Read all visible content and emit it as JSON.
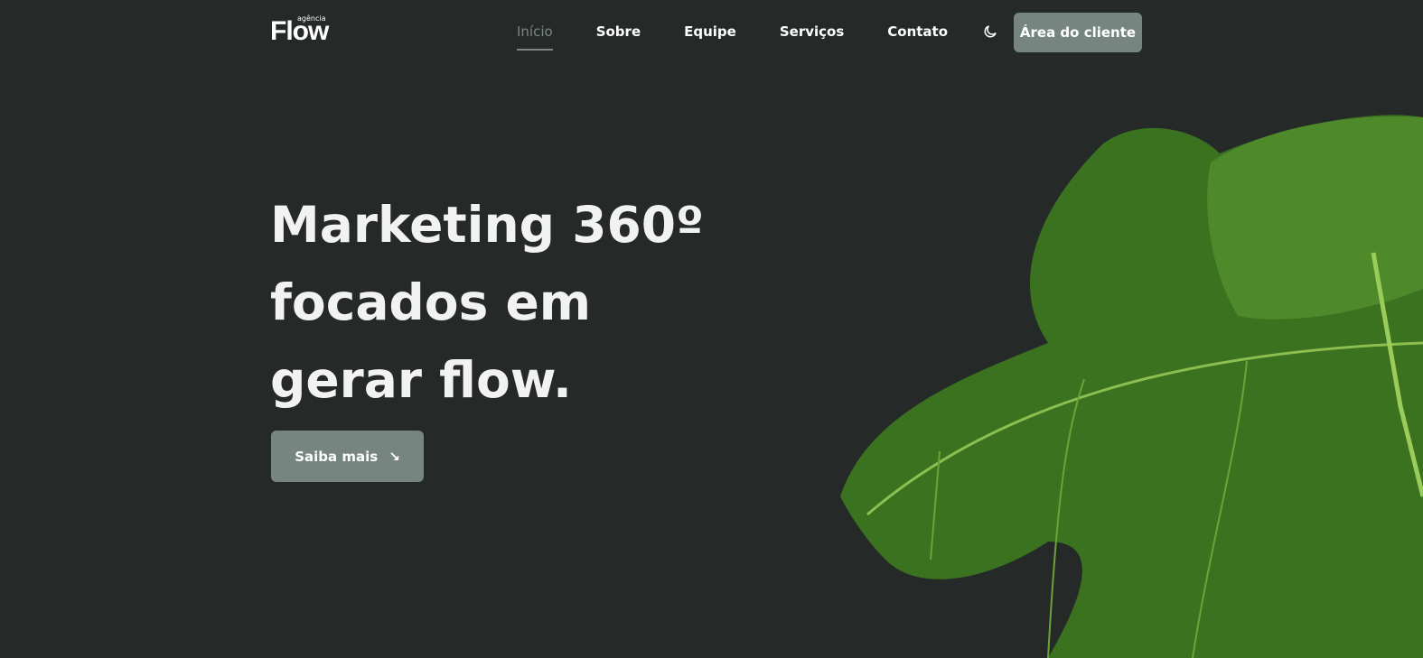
{
  "logo": {
    "small": "agência",
    "big": "Flow"
  },
  "nav": {
    "items": [
      "Início",
      "Sobre",
      "Equipe",
      "Serviços",
      "Contato"
    ],
    "active": "Início"
  },
  "theme_toggle_icon": "moon-icon",
  "client_button": "Área do cliente",
  "hero": {
    "title": "Marketing 360º focados em gerar flow.",
    "cta": "Saiba mais",
    "cta_icon": "arrow-down-right-icon"
  },
  "colors": {
    "background": "#252a29",
    "button": "#778580",
    "leaf": "#3f7a1e"
  }
}
